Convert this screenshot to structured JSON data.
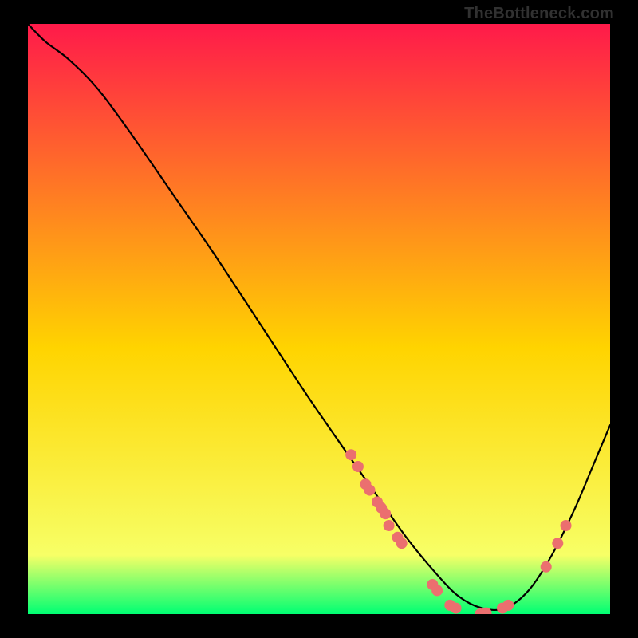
{
  "watermark": "TheBottleneck.com",
  "chart_data": {
    "type": "line",
    "title": "",
    "xlabel": "",
    "ylabel": "",
    "xlim": [
      0,
      100
    ],
    "ylim": [
      0,
      100
    ],
    "grid": false,
    "legend": false,
    "series": [
      {
        "name": "curve",
        "x": [
          0,
          3,
          7,
          12,
          18,
          25,
          32,
          40,
          48,
          55,
          60,
          65,
          70,
          74,
          78,
          82,
          86,
          90,
          94,
          97,
          100
        ],
        "values": [
          100,
          97,
          94,
          89,
          81,
          71,
          61,
          49,
          37,
          27,
          20,
          13,
          7,
          3,
          1,
          1,
          4,
          10,
          18,
          25,
          32
        ]
      }
    ],
    "markers": [
      {
        "x": 55.5,
        "y": 27
      },
      {
        "x": 56.7,
        "y": 25
      },
      {
        "x": 58.0,
        "y": 22
      },
      {
        "x": 58.7,
        "y": 21
      },
      {
        "x": 60.0,
        "y": 19
      },
      {
        "x": 60.7,
        "y": 18
      },
      {
        "x": 61.4,
        "y": 17
      },
      {
        "x": 62.0,
        "y": 15
      },
      {
        "x": 63.5,
        "y": 13
      },
      {
        "x": 64.2,
        "y": 12
      },
      {
        "x": 69.5,
        "y": 5
      },
      {
        "x": 70.3,
        "y": 4
      },
      {
        "x": 72.5,
        "y": 1.5
      },
      {
        "x": 73.5,
        "y": 1
      },
      {
        "x": 77.7,
        "y": 0
      },
      {
        "x": 78.7,
        "y": 0.2
      },
      {
        "x": 81.5,
        "y": 1
      },
      {
        "x": 82.5,
        "y": 1.5
      },
      {
        "x": 89.0,
        "y": 8
      },
      {
        "x": 91.0,
        "y": 12
      },
      {
        "x": 92.4,
        "y": 15
      }
    ],
    "colors": {
      "gradient_top": "#ff1a4a",
      "gradient_mid": "#ffd400",
      "gradient_bot": "#00ff73",
      "curve": "#000000",
      "marker_fill": "#eb6f6f"
    }
  }
}
